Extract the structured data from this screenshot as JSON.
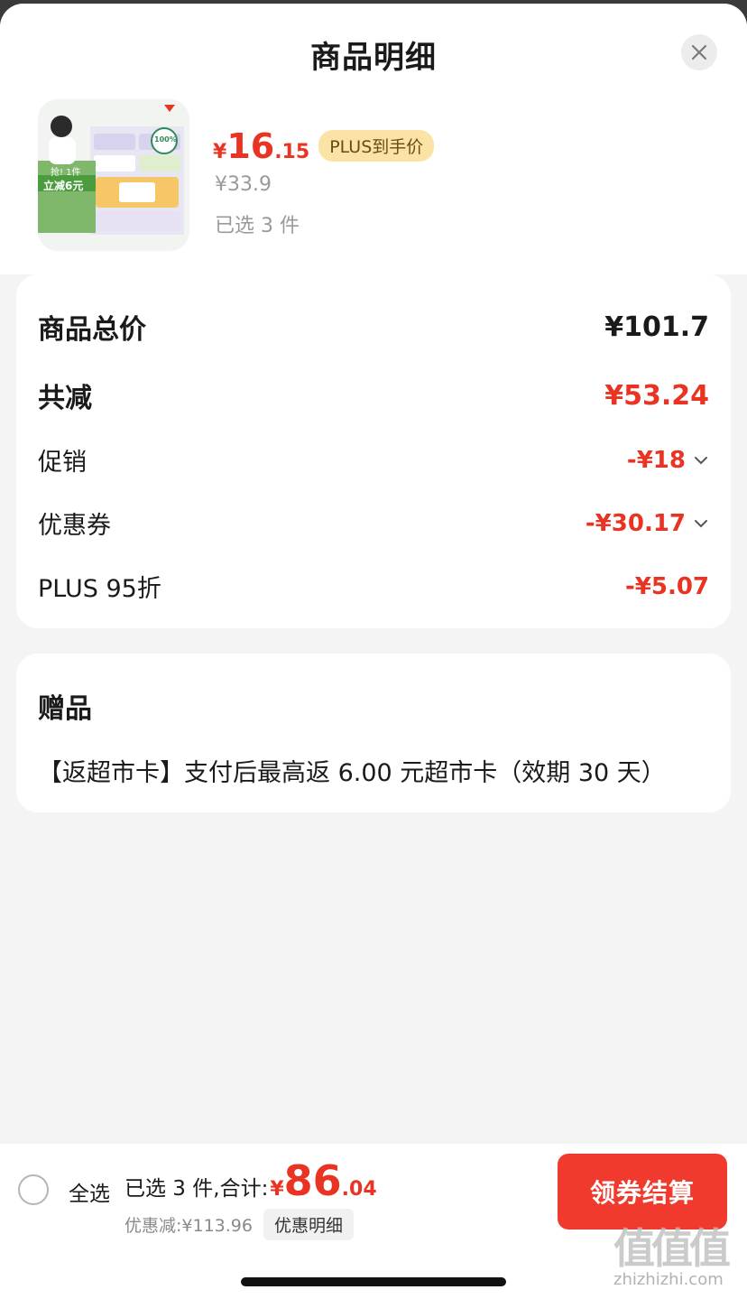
{
  "header": {
    "title": "商品明细"
  },
  "product": {
    "image_texts": {
      "promo_small": "抢! 1件",
      "promo_big": "立减6元",
      "badge": "100%"
    },
    "price_symbol": "¥",
    "price_int": "16",
    "price_dec": ".15",
    "plus_tag": "PLUS到手价",
    "original_price": "¥33.9",
    "selected_count": "已选 3 件"
  },
  "summary": {
    "total_label": "商品总价",
    "total_value": "¥101.7",
    "reduce_label": "共减",
    "reduce_value": "¥53.24",
    "items": [
      {
        "label": "促销",
        "value": "-¥18",
        "expandable": true
      },
      {
        "label": "优惠券",
        "value": "-¥30.17",
        "expandable": true
      },
      {
        "label": "PLUS 95折",
        "value": "-¥5.07",
        "expandable": false
      }
    ]
  },
  "gift": {
    "title": "赠品",
    "text": "【返超市卡】支付后最高返 6.00 元超市卡（效期 30 天）"
  },
  "bottom": {
    "select_all": "全选",
    "selected_total_label": "已选 3 件,合计:",
    "total_symbol": "¥",
    "total_int": "86",
    "total_dec": ".04",
    "discount_text": "优惠减:¥113.96",
    "detail_button": "优惠明细",
    "checkout_button": "领券结算"
  },
  "watermark": {
    "glyphs": "值值值",
    "site": "zhizhizhi.com"
  },
  "colors": {
    "accent_red": "#e93323",
    "button_red": "#f03a2e",
    "plus_tag_bg": "#fbe3a6"
  }
}
